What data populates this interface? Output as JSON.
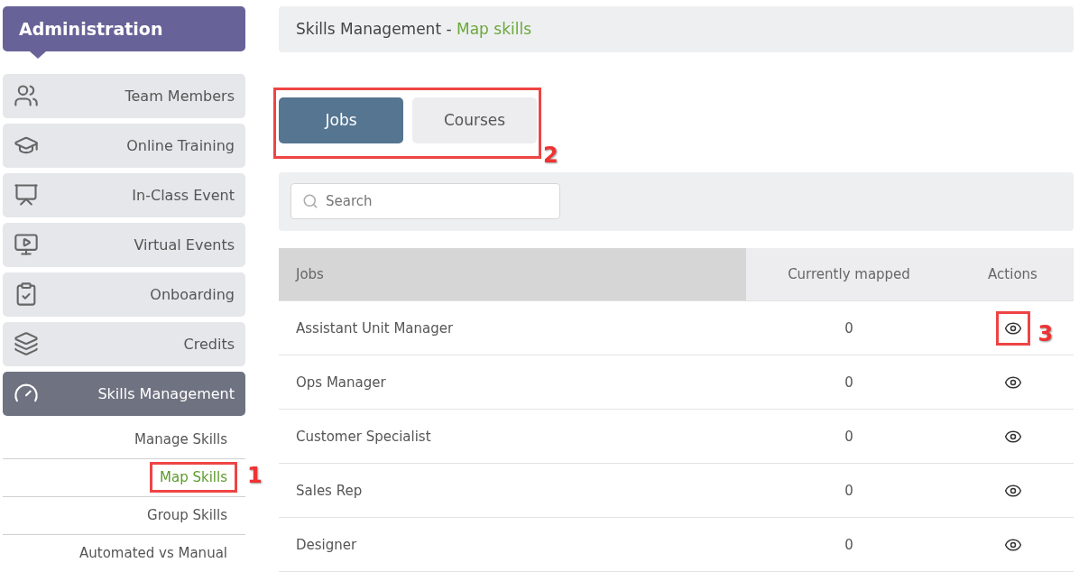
{
  "sidebar": {
    "title": "Administration",
    "items": [
      {
        "label": "Team Members",
        "selected": false
      },
      {
        "label": "Online Training",
        "selected": false
      },
      {
        "label": "In-Class Event",
        "selected": false
      },
      {
        "label": "Virtual Events",
        "selected": false
      },
      {
        "label": "Onboarding",
        "selected": false
      },
      {
        "label": "Credits",
        "selected": false
      },
      {
        "label": "Skills Management",
        "selected": true
      }
    ],
    "submenu": [
      {
        "label": "Manage Skills",
        "selected": false
      },
      {
        "label": "Map Skills",
        "selected": true,
        "annotation": "1"
      },
      {
        "label": "Group Skills",
        "selected": false
      },
      {
        "label": "Automated vs Manual",
        "selected": false
      }
    ]
  },
  "breadcrumb": {
    "section": "Skills Management - ",
    "page": "Map skills"
  },
  "tabs": {
    "annotation": "2",
    "items": [
      {
        "label": "Jobs",
        "selected": true
      },
      {
        "label": "Courses",
        "selected": false
      }
    ]
  },
  "search": {
    "placeholder": "Search"
  },
  "table": {
    "columns": [
      "Jobs",
      "Currently mapped",
      "Actions"
    ],
    "rows": [
      {
        "job": "Assistant Unit Manager",
        "mapped": "0",
        "annotation": "3"
      },
      {
        "job": "Ops Manager",
        "mapped": "0"
      },
      {
        "job": "Customer Specialist",
        "mapped": "0"
      },
      {
        "job": "Sales Rep",
        "mapped": "0"
      },
      {
        "job": "Designer",
        "mapped": "0"
      }
    ]
  }
}
